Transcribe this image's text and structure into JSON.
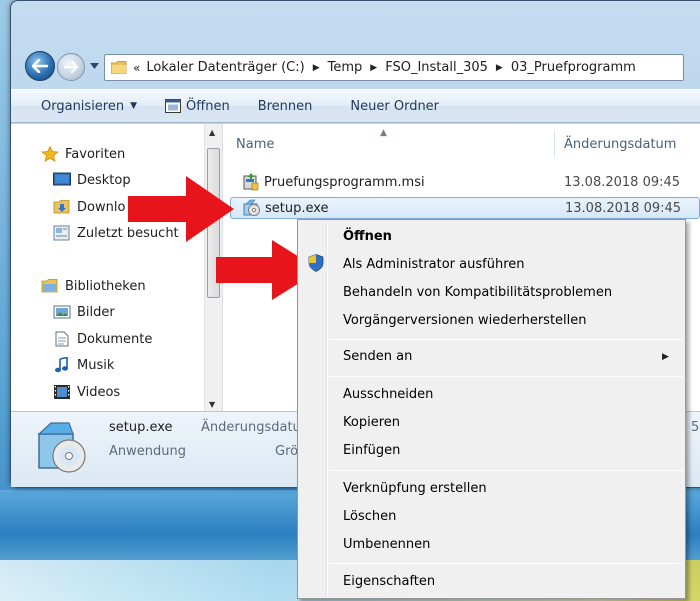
{
  "address_bar": {
    "prefix": "«",
    "crumbs": [
      "Lokaler Datenträger (C:)",
      "Temp",
      "FSO_Install_305",
      "03_Pruefprogramm"
    ]
  },
  "toolbar": {
    "organize_label": "Organisieren",
    "open_label": "Öffnen",
    "burn_label": "Brennen",
    "new_folder_label": "Neuer Ordner"
  },
  "nav_pane": {
    "favorites": "Favoriten",
    "desktop": "Desktop",
    "downloads": "Downlo",
    "recent": "Zuletzt besucht",
    "libraries": "Bibliotheken",
    "pictures": "Bilder",
    "documents": "Dokumente",
    "music": "Musik",
    "videos": "Videos"
  },
  "file_list": {
    "col_name": "Name",
    "col_date": "Änderungsdatum",
    "rows": [
      {
        "name": "Pruefungsprogramm.msi",
        "date": "13.08.2018 09:45"
      },
      {
        "name": "setup.exe",
        "date": "13.08.2018 09:45"
      }
    ]
  },
  "details": {
    "file_name": "setup.exe",
    "file_type": "Anwendung",
    "date_label": "Änderungsdatu",
    "size_label": "Grö",
    "tail": "5"
  },
  "context_menu": {
    "items": [
      "Öffnen",
      "Als Administrator ausführen",
      "Behandeln von Kompatibilitätsproblemen",
      "Vorgängerversionen wiederherstellen",
      "Senden an",
      "Ausschneiden",
      "Kopieren",
      "Einfügen",
      "Verknüpfung erstellen",
      "Löschen",
      "Umbenennen",
      "Eigenschaften"
    ]
  },
  "colors": {
    "arrow_red": "#e8141b",
    "selection_border": "#84acdd",
    "toolbar_text": "#1e395b"
  }
}
